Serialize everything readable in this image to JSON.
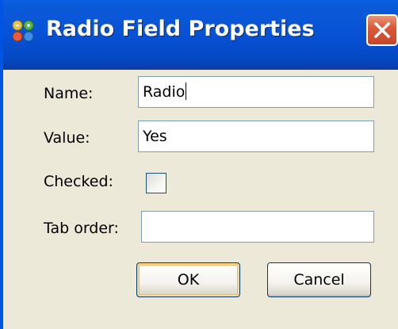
{
  "window": {
    "title": "Radio Field Properties",
    "icon": "app-dots-icon",
    "close_icon": "close-icon",
    "accent_color": "#0054e3",
    "close_color": "#c8452a"
  },
  "form": {
    "name_label": "Name:",
    "name_value": "Radio",
    "value_label": "Value:",
    "value_value": "Yes",
    "checked_label": "Checked:",
    "checked_state": false,
    "tab_order_label": "Tab order:",
    "tab_order_value": ""
  },
  "buttons": {
    "ok_label": "OK",
    "cancel_label": "Cancel"
  }
}
